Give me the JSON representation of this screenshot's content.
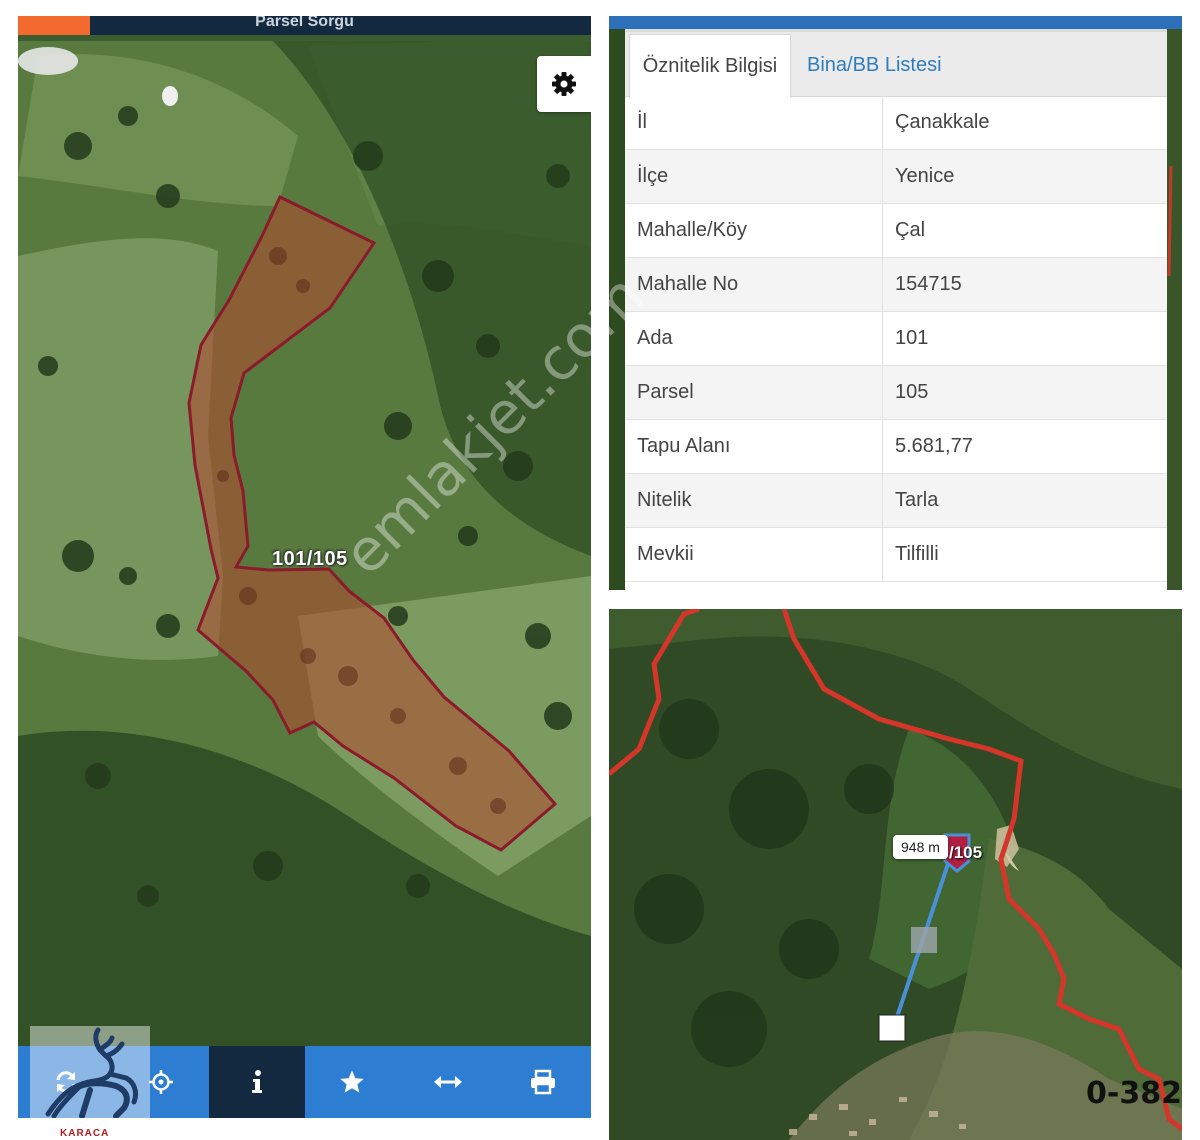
{
  "left_map": {
    "header_title": "Parsel Sorgu",
    "parcel_label": "101/105",
    "toolbar": [
      {
        "icon": "refresh-icon",
        "active": false
      },
      {
        "icon": "crosshair-icon",
        "active": false
      },
      {
        "icon": "info-icon",
        "active": true
      },
      {
        "icon": "star-icon",
        "active": false
      },
      {
        "icon": "measure-arrows-icon",
        "active": false
      },
      {
        "icon": "print-icon",
        "active": false
      }
    ],
    "logo_text": "KARACA"
  },
  "attributes": {
    "tabs": [
      {
        "label": "Öznitelik Bilgisi",
        "active": true
      },
      {
        "label": "Bina/BB Listesi",
        "active": false
      }
    ],
    "rows": [
      {
        "key": "İl",
        "value": "Çanakkale"
      },
      {
        "key": "İlçe",
        "value": "Yenice"
      },
      {
        "key": "Mahalle/Köy",
        "value": "Çal"
      },
      {
        "key": "Mahalle No",
        "value": "154715"
      },
      {
        "key": "Ada",
        "value": "101"
      },
      {
        "key": "Parsel",
        "value": "105"
      },
      {
        "key": "Tapu Alanı",
        "value": "5.681,77"
      },
      {
        "key": "Nitelik",
        "value": "Tarla"
      },
      {
        "key": "Mevkii",
        "value": "Tilfilli"
      }
    ]
  },
  "overview_map": {
    "distance_label": "948 m",
    "parcel_label": "/105",
    "listing_code": "0-382"
  },
  "watermark": "emlakjet.com",
  "colors": {
    "toolbar_blue": "#2d7dd2",
    "header_navy": "#13293f",
    "accent_orange": "#f26a2e",
    "parcel_red": "#8b1a2b",
    "link_blue": "#2e7dbf"
  }
}
